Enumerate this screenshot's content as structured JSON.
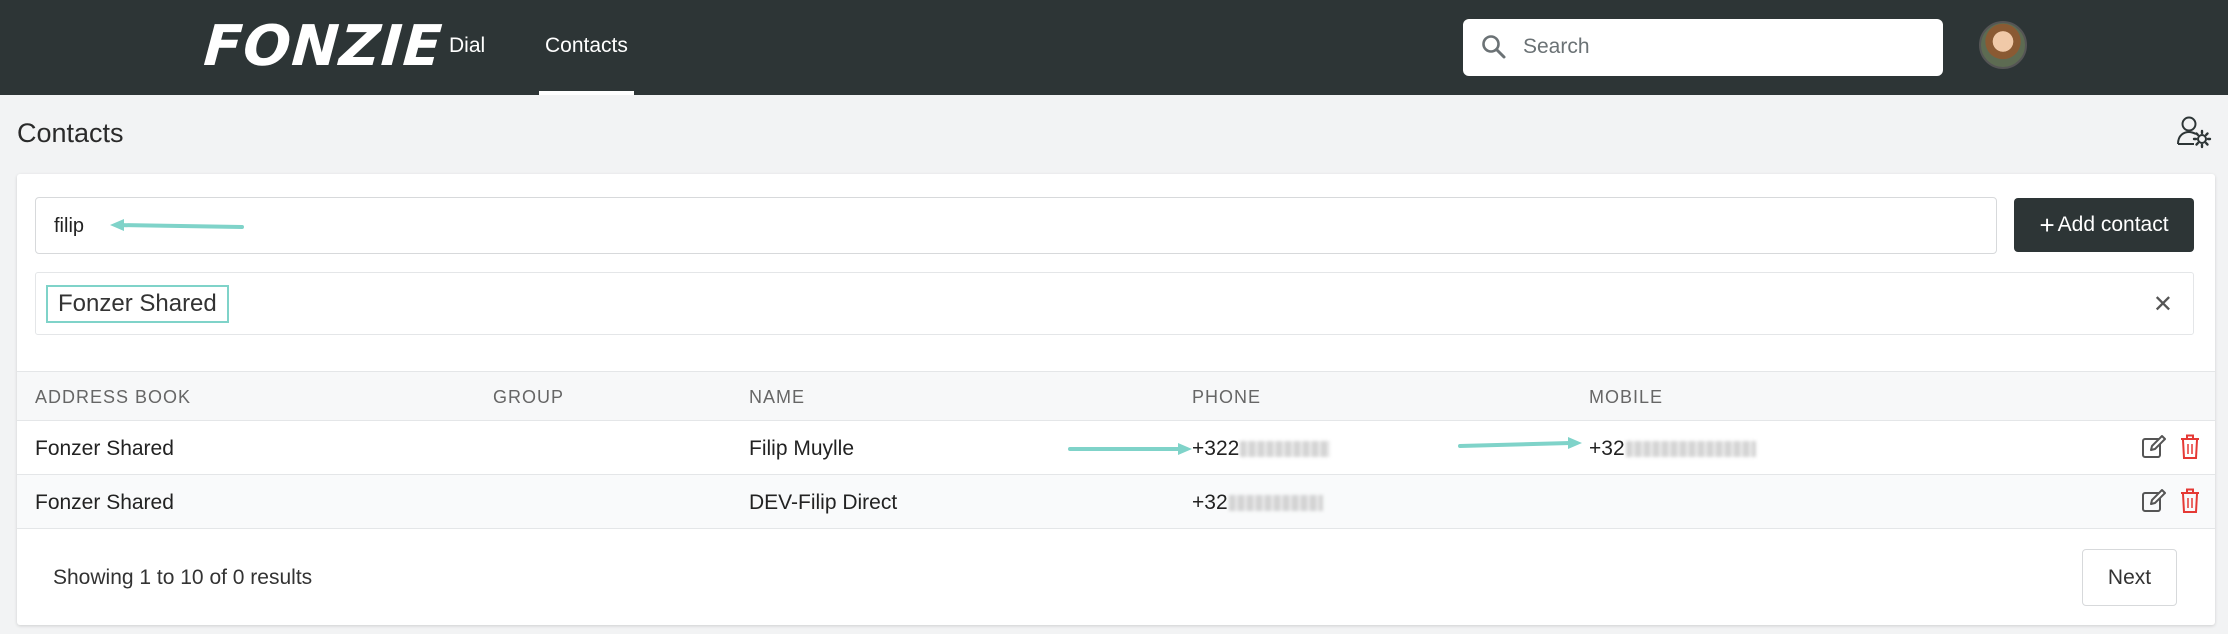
{
  "header": {
    "logo": "FONZIE",
    "nav": [
      {
        "label": "Dial"
      },
      {
        "label": "Contacts"
      }
    ],
    "search": {
      "placeholder": "Search",
      "value": ""
    }
  },
  "page": {
    "title": "Contacts"
  },
  "filter": {
    "value": "filip",
    "add_button_label": "Add contact",
    "selected_tag": "Fonzer Shared"
  },
  "table": {
    "columns": [
      "ADDRESS BOOK",
      "GROUP",
      "NAME",
      "PHONE",
      "MOBILE"
    ],
    "rows": [
      {
        "address_book": "Fonzer Shared",
        "group": "",
        "name": "Filip Muylle",
        "phone_prefix": "+322",
        "mobile_prefix": "+32"
      },
      {
        "address_book": "Fonzer Shared",
        "group": "",
        "name": "DEV-Filip Direct",
        "phone_prefix": "+32",
        "mobile_prefix": ""
      }
    ]
  },
  "footer": {
    "summary": "Showing 1 to 10 of 0 results",
    "next_label": "Next"
  },
  "colors": {
    "topbar": "#2d3536",
    "annotation_teal": "#7fd3c9",
    "delete_red": "#e53935"
  }
}
